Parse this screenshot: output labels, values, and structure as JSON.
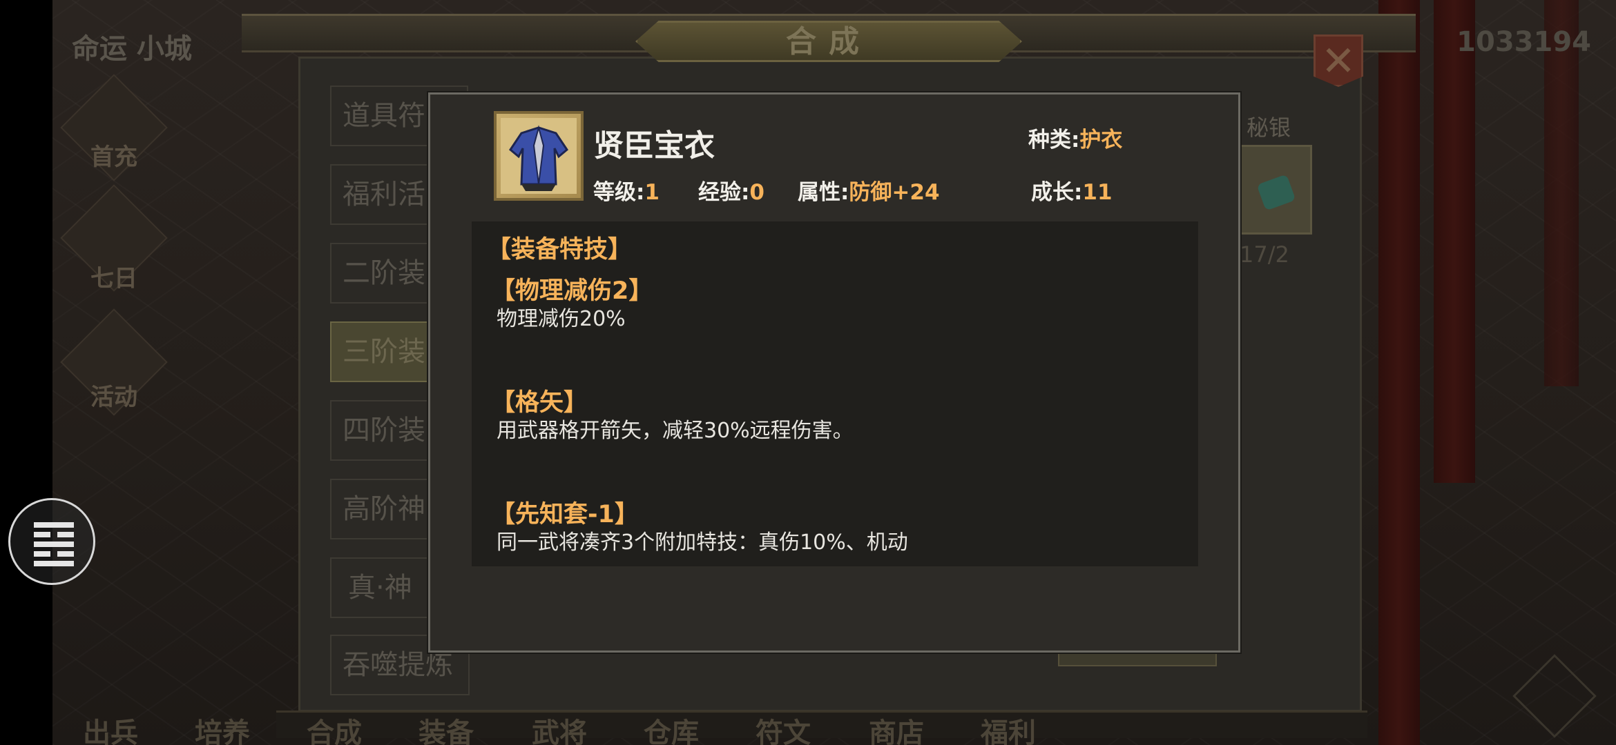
{
  "header": {
    "city_name": "命运 小城",
    "window_title": "合成",
    "gold": "1033194"
  },
  "side_menu": [
    {
      "label": "首充",
      "icon": "first-charge-icon"
    },
    {
      "label": "七日",
      "icon": "seven-day-icon"
    },
    {
      "label": "活动",
      "icon": "event-icon"
    }
  ],
  "categories": [
    {
      "label": "道具符"
    },
    {
      "label": "福利活"
    },
    {
      "label": "二阶装"
    },
    {
      "label": "三阶装",
      "active": true
    },
    {
      "label": "四阶装"
    },
    {
      "label": "高阶神"
    },
    {
      "label": "真·神"
    },
    {
      "label": "吞噬提炼"
    }
  ],
  "material": {
    "name": "秘银",
    "count": "17/2"
  },
  "bottom_nav": [
    "出兵",
    "培养",
    "合成",
    "装备",
    "武将",
    "仓库",
    "符文",
    "商店",
    "福利"
  ],
  "item": {
    "name": "贤臣宝衣",
    "icon": "blue-robe-icon",
    "type_label": "种类:",
    "type_value": "护衣",
    "level_label": "等级:",
    "level_value": "1",
    "exp_label": "经验:",
    "exp_value": "0",
    "attr_label": "属性:",
    "attr_value": "防御+24",
    "growth_label": "成长:",
    "growth_value": "11"
  },
  "skills": {
    "section_title": "【装备特技】",
    "list": [
      {
        "title": "【物理减伤2】",
        "desc": "物理减伤20%"
      },
      {
        "title": "【格矢】",
        "desc": "用武器格开箭矢，减轻30%远程伤害。"
      },
      {
        "title": "【先知套-1】",
        "desc": "同一武将凑齐3个附加特技：真伤10%、机动"
      }
    ]
  },
  "colors": {
    "accent": "#f7b35a",
    "modal_bg": "#2d2b27",
    "panel_bg": "#201f1c"
  }
}
